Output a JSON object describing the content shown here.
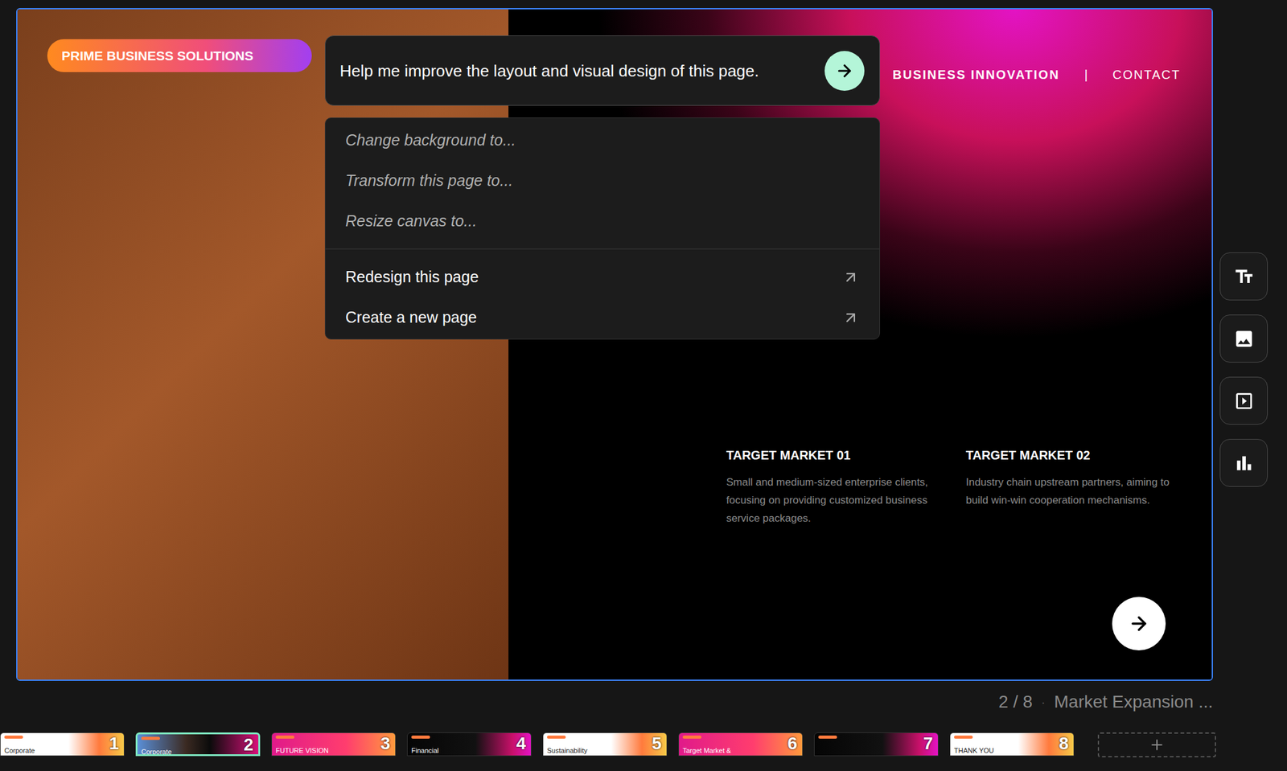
{
  "canvas": {
    "badge": "PRIME BUSINESS SOLUTIONS",
    "nav": [
      {
        "label": "BUSINESS INNOVATION",
        "kind": "primary"
      },
      {
        "label": "|",
        "kind": "separator"
      },
      {
        "label": "CONTACT",
        "kind": "link"
      }
    ],
    "markets": [
      {
        "title": "TARGET MARKET 01",
        "description": "Small and medium-sized enterprise clients, focusing on providing customized business service packages."
      },
      {
        "title": "TARGET MARKET 02",
        "description": "Industry chain upstream partners, aiming to build win-win cooperation mechanisms."
      }
    ]
  },
  "prompt": {
    "text": "Help me improve the layout and visual design of this page.",
    "suggestions": [
      "Change background to...",
      "Transform this page to...",
      "Resize canvas to..."
    ],
    "actions": [
      "Redesign this page",
      "Create a new page"
    ]
  },
  "pager": {
    "page": "2 / 8",
    "separator": "·",
    "title": "Market Expansion ..."
  },
  "thumbnails": [
    {
      "number": "1",
      "label": "Corporate",
      "kind": "light",
      "selected": false
    },
    {
      "number": "2",
      "label": "Corporate",
      "kind": "photo",
      "selected": true
    },
    {
      "number": "3",
      "label": "FUTURE VISION",
      "kind": "pink",
      "selected": false
    },
    {
      "number": "4",
      "label": "Financial",
      "kind": "dark",
      "selected": false
    },
    {
      "number": "5",
      "label": "Sustainability",
      "kind": "light",
      "selected": false
    },
    {
      "number": "6",
      "label": "Target Market &",
      "kind": "pink",
      "selected": false
    },
    {
      "number": "7",
      "label": "",
      "kind": "dark",
      "selected": false
    },
    {
      "number": "8",
      "label": "THANK YOU",
      "kind": "light",
      "selected": false
    }
  ]
}
